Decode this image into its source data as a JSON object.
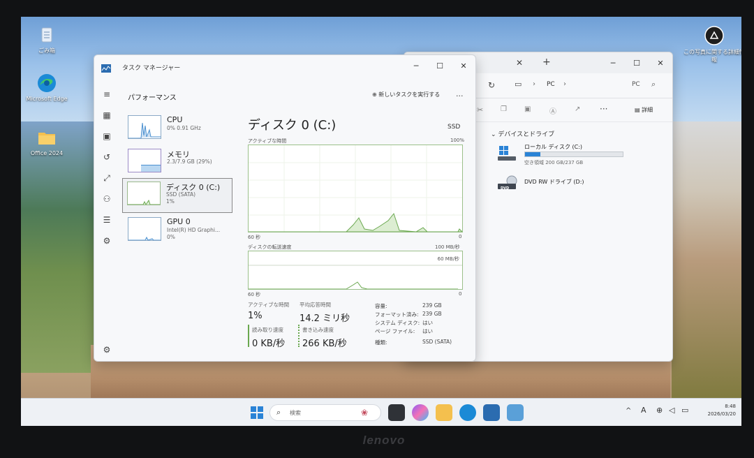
{
  "desktop": {
    "icons": [
      {
        "label": "ごみ箱",
        "icon": "recycle-bin-icon"
      },
      {
        "label": "Microsoft Edge",
        "icon": "edge-icon"
      },
      {
        "label": "Office 2024",
        "icon": "folder-icon"
      }
    ],
    "spotlight_label": "この写真に関する詳細情報"
  },
  "task_manager": {
    "title": "タスク マネージャー",
    "section": "パフォーマンス",
    "run_task": "新しいタスクを実行する",
    "more": "...",
    "items": [
      {
        "name": "CPU",
        "sub1": "0% 0.91 GHz",
        "sub2": "",
        "sub3": ""
      },
      {
        "name": "メモリ",
        "sub1": "2.3/7.9 GB (29%)",
        "sub2": "",
        "sub3": ""
      },
      {
        "name": "ディスク 0 (C:)",
        "sub1": "SSD (SATA)",
        "sub2": "1%",
        "sub3": ""
      },
      {
        "name": "GPU 0",
        "sub1": "Intel(R) HD Graphi...",
        "sub2": "0%",
        "sub3": ""
      }
    ],
    "detail": {
      "title": "ディスク 0 (C:)",
      "type": "SSD",
      "active_time_label": "アクティブな時間",
      "active_max": "100%",
      "axis_left": "60 秒",
      "axis_right": "0",
      "transfer_label": "ディスクの転送速度",
      "transfer_max": "100 MB/秒",
      "transfer_mid": "60 MB/秒",
      "axis_left2": "60 秒",
      "axis_right2": "0",
      "active_time": "1%",
      "avg_response_label": "平均応答時間",
      "avg_response": "14.2 ミリ秒",
      "read_label": "読み取り速度",
      "read": "0 KB/秒",
      "write_label": "書き込み速度",
      "write": "266 KB/秒",
      "props": [
        {
          "k": "容量:",
          "v": "239 GB"
        },
        {
          "k": "フォーマット済み:",
          "v": "239 GB"
        },
        {
          "k": "システム ディスク:",
          "v": "はい"
        },
        {
          "k": "ページ ファイル:",
          "v": "はい"
        },
        {
          "k": "種類:",
          "v": "SSD (SATA)"
        }
      ]
    }
  },
  "explorer": {
    "address_pc": "PC",
    "search_label": "PC",
    "details_label": "詳細",
    "group": "デバイスとドライブ",
    "drive1_name": "ローカル ディスク (C:)",
    "drive1_free": "空き領域 200 GB/237 GB",
    "drive1_used_fraction": 0.156,
    "drive2_name": "DVD RW ドライブ (D:)",
    "dvd_badge": "DVD"
  },
  "taskbar": {
    "search_placeholder": "検索",
    "time": "8:48",
    "date": "2026/03/20"
  },
  "laptop_brand": "lenovo"
}
